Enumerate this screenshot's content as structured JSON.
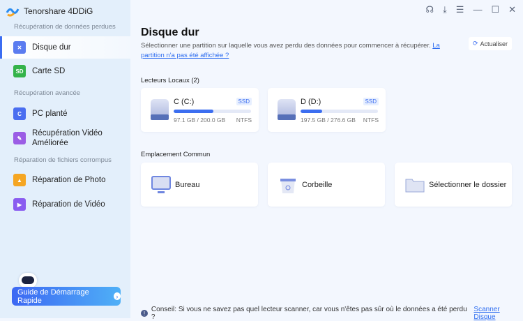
{
  "app": {
    "title": "Tenorshare 4DDiG"
  },
  "sidebar": {
    "sections": [
      "Récupération de données perdues",
      "Récupération avancée",
      "Réparation de fichiers corrompus"
    ],
    "items": [
      {
        "label": "Disque dur",
        "icon": "hard-drive-icon",
        "active": true
      },
      {
        "label": "Carte SD",
        "icon": "sd-card-icon"
      },
      {
        "label": "PC planté",
        "icon": "crashed-pc-icon"
      },
      {
        "label": "Récupération Vidéo Améliorée",
        "icon": "video-repair-icon"
      },
      {
        "label": "Réparation de Photo",
        "icon": "photo-icon"
      },
      {
        "label": "Réparation de Vidéo",
        "icon": "video-icon"
      }
    ],
    "guide_label": "Guide de Démarrage Rapide"
  },
  "window_icons": [
    "headset-icon",
    "download-icon",
    "menu-icon",
    "minimize-icon",
    "maximize-icon",
    "close-icon"
  ],
  "main": {
    "title": "Disque dur",
    "description": "Sélectionner une partition sur laquelle vous avez perdu des données pour commencer à récupérer.",
    "help_link": "La partition n'a pas été affichée ?",
    "refresh_label": "Actualiser",
    "local_label": "Lecteurs Locaux (2)",
    "drives": [
      {
        "name": "C (C:)",
        "type": "SSD",
        "size": "97.1 GB / 200.0 GB",
        "fs": "NTFS",
        "fill": 0.51
      },
      {
        "name": "D (D:)",
        "type": "SSD",
        "size": "197.5 GB / 276.6 GB",
        "fs": "NTFS",
        "fill": 0.28
      }
    ],
    "common_label": "Emplacement Commun",
    "locations": [
      {
        "label": "Bureau",
        "icon": "desktop-icon"
      },
      {
        "label": "Corbeille",
        "icon": "recycle-bin-icon"
      },
      {
        "label": "Sélectionner le dossier",
        "icon": "folder-icon"
      }
    ],
    "tip": "Conseil: Si vous ne savez pas quel lecteur scanner, car vous n'êtes pas sûr où le données a été perdu ?",
    "tip_link": "Scanner Disque"
  },
  "colors": {
    "accent": "#3c6ef0",
    "sidebar_bg": "#e3effb",
    "main_bg": "#f3f7fe"
  }
}
